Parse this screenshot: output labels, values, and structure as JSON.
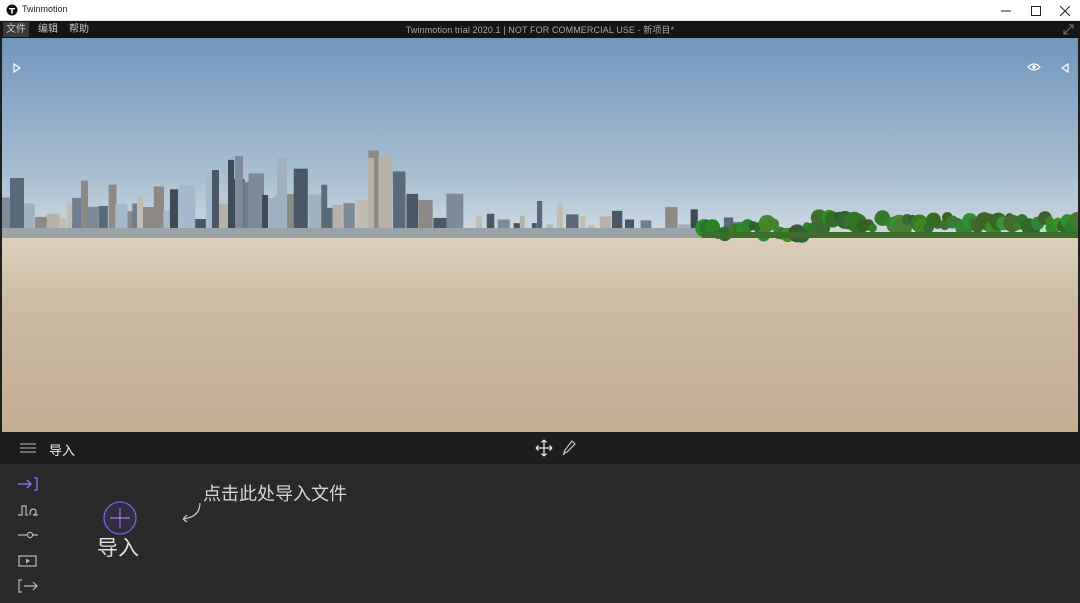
{
  "window": {
    "app_title": "Twinmotion"
  },
  "menubar": {
    "items": [
      {
        "label": "文件"
      },
      {
        "label": "编辑"
      },
      {
        "label": "帮助"
      }
    ],
    "doc_title": "Twinmotion trial 2020.1 | NOT FOR COMMERCIAL USE - 新项目*"
  },
  "toolbar": {
    "section_title": "导入"
  },
  "panel": {
    "hint_text": "点击此处导入文件",
    "import_label": "导入",
    "sidebar_icons": [
      "import-icon",
      "waveform-icon",
      "slider-icon",
      "media-icon",
      "export-icon"
    ]
  },
  "icons": {
    "accent": "#9a6cff"
  },
  "colors": {
    "sky_top": "#6f96bd",
    "sky_horizon": "#c9d7e1",
    "ground": "#c9b79d",
    "panel_bg": "#2a2a2a",
    "toolbar_bg": "#1d1d1d"
  }
}
